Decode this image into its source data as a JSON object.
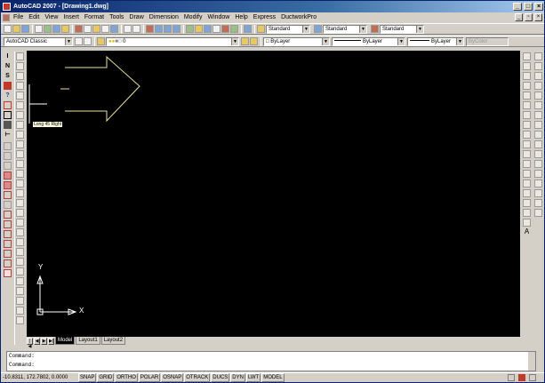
{
  "window": {
    "title": "AutoCAD 2007 - [Drawing1.dwg]"
  },
  "menu": [
    "File",
    "Edit",
    "View",
    "Insert",
    "Format",
    "Tools",
    "Draw",
    "Dimension",
    "Modify",
    "Window",
    "Help",
    "Express",
    "DuctworkPro"
  ],
  "styles_toolbar": {
    "text_style": "Standard",
    "dim_style": "Standard",
    "table_style": "Standard"
  },
  "workspace_toolbar": {
    "workspace": "AutoCAD Classic",
    "layer": "0"
  },
  "properties_toolbar": {
    "color": "ByLayer",
    "linetype": "ByLayer",
    "lineweight": "ByLayer",
    "plot_style": "ByColor"
  },
  "left_toolbar_letters": [
    "I",
    "N",
    "S",
    "",
    "?",
    "",
    "",
    "",
    ""
  ],
  "tooltip": "Long 45 Right",
  "ucs": {
    "x_label": "X",
    "y_label": "Y"
  },
  "layout_tabs": [
    "Model",
    "Layout1",
    "Layout2"
  ],
  "active_tab": "Model",
  "command_lines": [
    "Command:",
    "Command:"
  ],
  "status": {
    "coordinates": "-10.8311, 172.7802, 0.0000",
    "buttons": [
      "SNAP",
      "GRID",
      "ORTHO",
      "POLAR",
      "OSNAP",
      "OTRACK",
      "DUCS",
      "DYN",
      "LWT",
      "MODEL"
    ]
  },
  "colors": {
    "canvas": "#000000",
    "arrow": "#e8e39a",
    "title_start": "#0a246a"
  }
}
